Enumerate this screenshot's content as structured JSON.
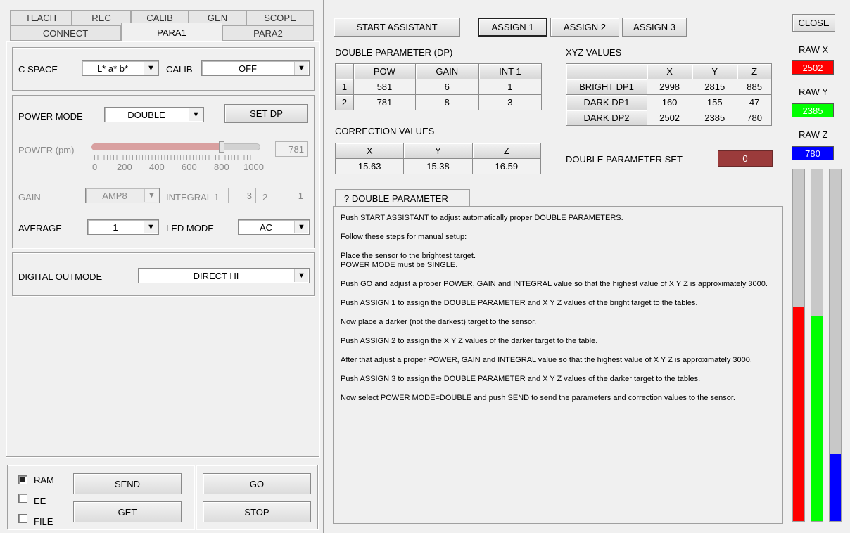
{
  "tabs_row1": [
    "TEACH",
    "REC",
    "CALIB",
    "GEN",
    "SCOPE"
  ],
  "tabs_row2": [
    "CONNECT",
    "PARA1",
    "PARA2"
  ],
  "para1": {
    "c_space_label": "C SPACE",
    "c_space_value": "L* a* b*",
    "calib_label": "CALIB",
    "calib_value": "OFF",
    "power_mode_label": "POWER MODE",
    "power_mode_value": "DOUBLE",
    "set_dp": "SET DP",
    "power_label": "POWER (pm)",
    "power_value": "781",
    "power_fraction": 0.781,
    "scale_ticks": [
      "0",
      "200",
      "400",
      "600",
      "800",
      "1000"
    ],
    "gain_label": "GAIN",
    "gain_value": "AMP8",
    "integral_label": "INTEGRAL 1",
    "integral1_value": "3",
    "integral2_label": "2",
    "integral2_value": "1",
    "average_label": "AVERAGE",
    "average_value": "1",
    "led_mode_label": "LED MODE",
    "led_mode_value": "AC",
    "digital_outmode_label": "DIGITAL OUTMODE",
    "digital_outmode_value": "DIRECT HI"
  },
  "bottom_left": {
    "ram": "RAM",
    "ee": "EE",
    "file": "FILE",
    "send": "SEND",
    "get": "GET",
    "go": "GO",
    "stop": "STOP"
  },
  "top_buttons": {
    "start_assistant": "START ASSISTANT",
    "assign1": "ASSIGN 1",
    "assign2": "ASSIGN 2",
    "assign3": "ASSIGN 3",
    "close": "CLOSE"
  },
  "dp_table": {
    "title": "DOUBLE PARAMETER (DP)",
    "headers": [
      "POW",
      "GAIN",
      "INT 1"
    ],
    "rows": [
      {
        "idx": "1",
        "cells": [
          "581",
          "6",
          "1"
        ]
      },
      {
        "idx": "2",
        "cells": [
          "781",
          "8",
          "3"
        ]
      }
    ]
  },
  "correction": {
    "title": "CORRECTION VALUES",
    "headers": [
      "X",
      "Y",
      "Z"
    ],
    "values": [
      "15.63",
      "15.38",
      "16.59"
    ]
  },
  "xyz_table": {
    "title": "XYZ VALUES",
    "headers": [
      "X",
      "Y",
      "Z"
    ],
    "rows": [
      {
        "label": "BRIGHT DP1",
        "cells": [
          "2998",
          "2815",
          "885"
        ]
      },
      {
        "label": "DARK DP1",
        "cells": [
          "160",
          "155",
          "47"
        ]
      },
      {
        "label": "DARK DP2",
        "cells": [
          "2502",
          "2385",
          "780"
        ]
      }
    ]
  },
  "dp_set": {
    "label": "DOUBLE PARAMETER SET",
    "value": "0"
  },
  "help_tab": "? DOUBLE PARAMETER",
  "help_text": [
    "Push START ASSISTANT to adjust automatically proper DOUBLE PARAMETERS.",
    "Follow these steps for manual setup:",
    "Place the sensor to the brightest target.\nPOWER MODE must be SINGLE.",
    "Push GO and adjust a proper POWER, GAIN and INTEGRAL value so that the highest value of X Y Z is approximately 3000.",
    "Push ASSIGN 1 to assign the DOUBLE PARAMETER and X Y Z values of the bright target to the tables.",
    "Now place a darker (not the darkest) target to the sensor.",
    "Push ASSIGN 2 to assign the X Y Z values of the darker target to the table.",
    "After that adjust a proper POWER, GAIN and INTEGRAL value so that the highest value of X Y Z is approximately 3000.",
    "Push ASSIGN 3 to assign the DOUBLE PARAMETER and X Y Z values of the darker target to the tables.",
    "Now select POWER MODE=DOUBLE and push SEND to send the parameters and correction values to the sensor."
  ],
  "raw": {
    "x_label": "RAW X",
    "x_value": "2502",
    "x_color": "#ff0000",
    "y_label": "RAW Y",
    "y_value": "2385",
    "y_color": "#00ff00",
    "z_label": "RAW Z",
    "z_value": "780",
    "z_color": "#0000ff",
    "max": 4096
  }
}
